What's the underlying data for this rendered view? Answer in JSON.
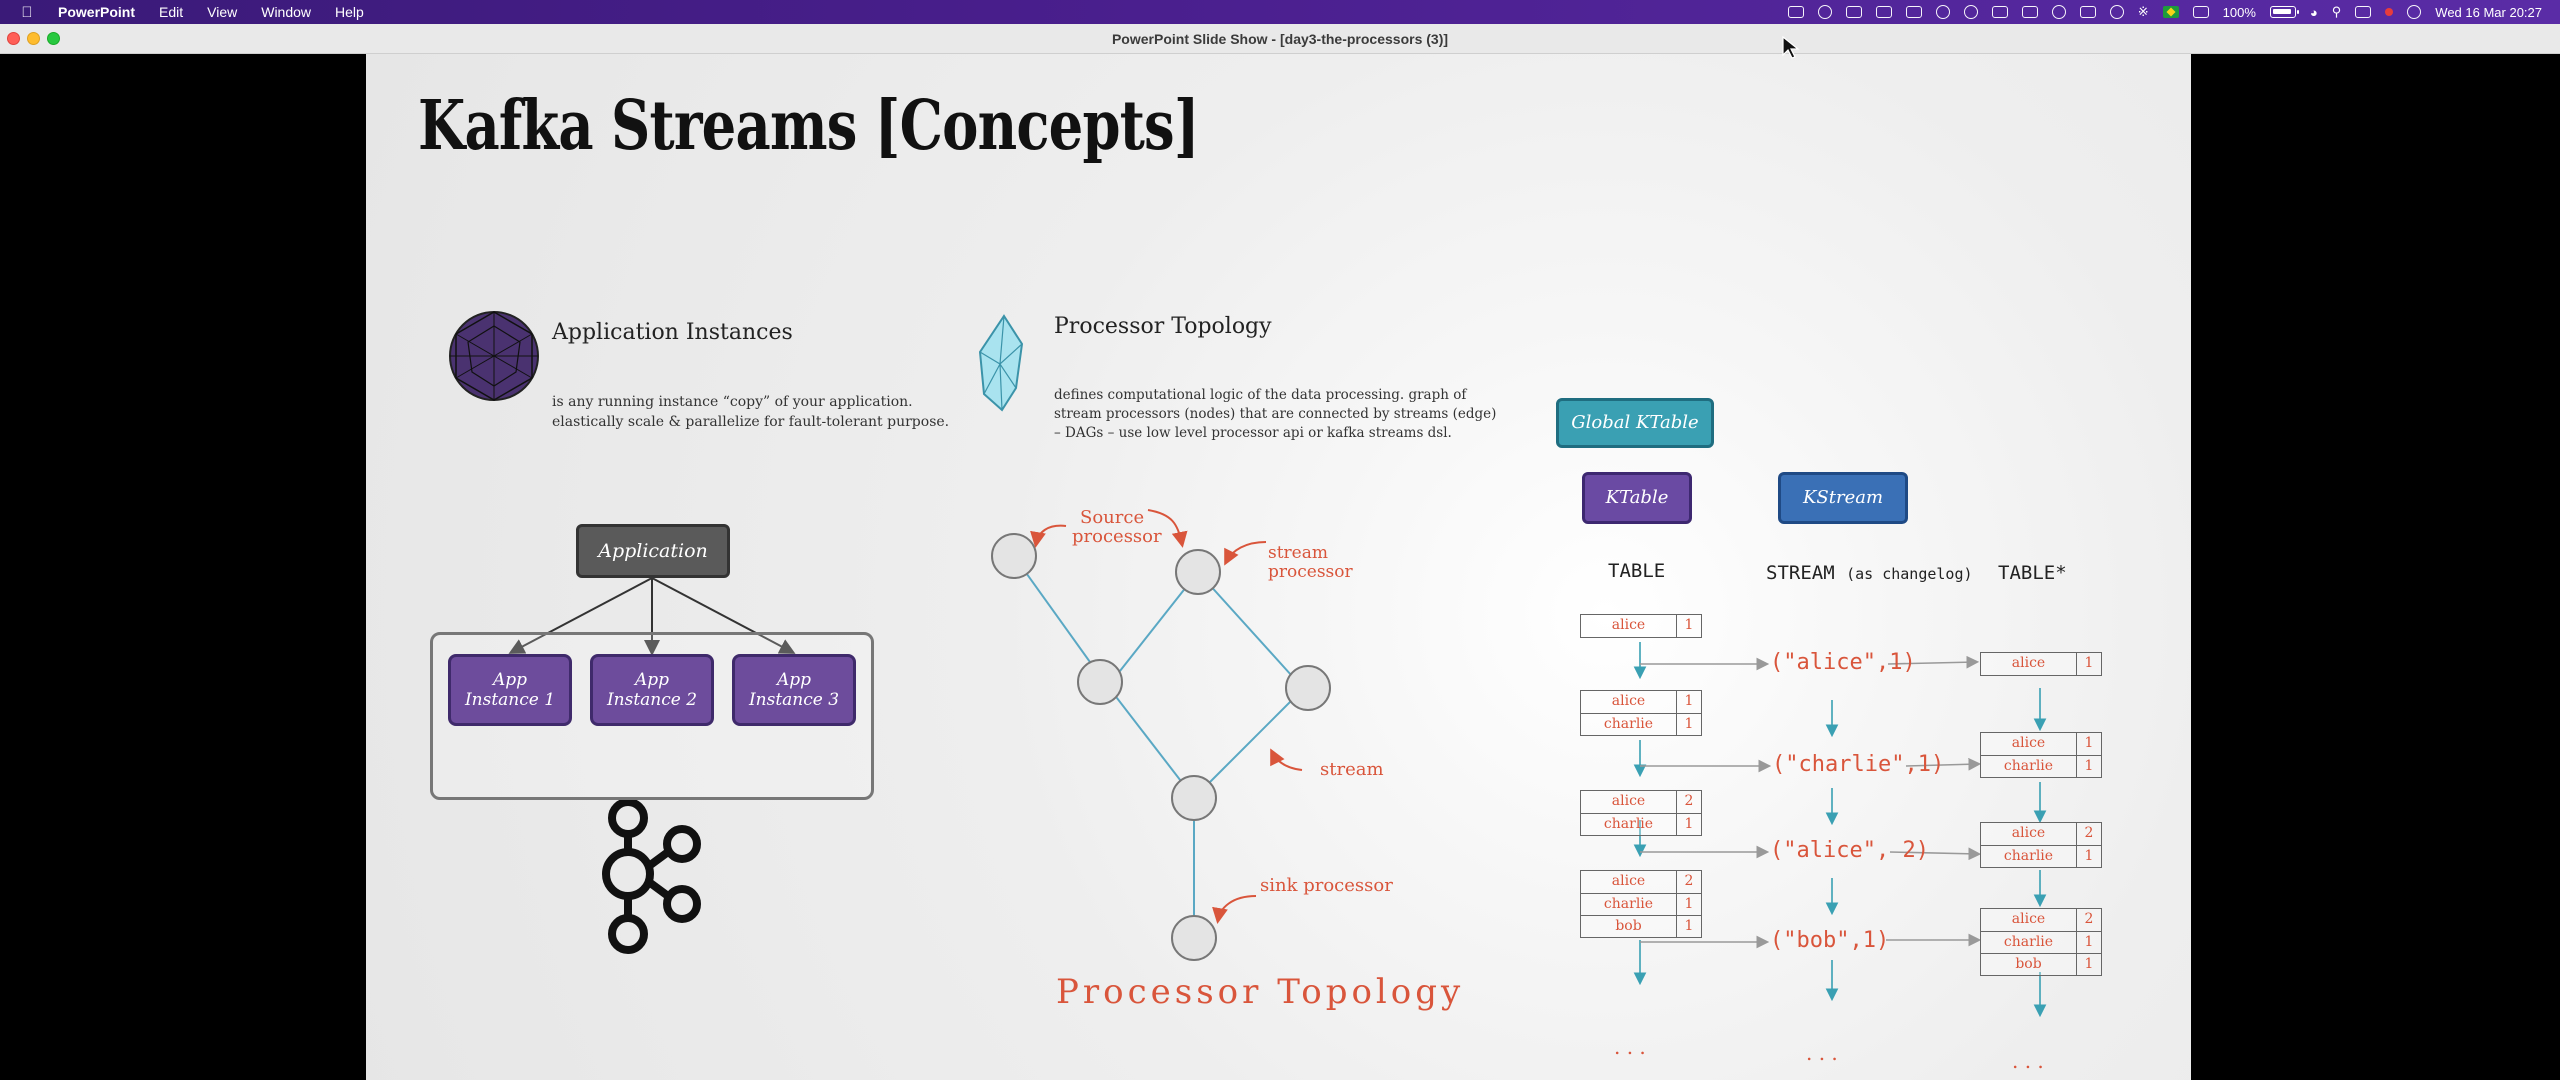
{
  "menubar": {
    "apple_icon": "apple-icon",
    "app_name": "PowerPoint",
    "menus": [
      "Edit",
      "View",
      "Window",
      "Help"
    ],
    "battery": "100%",
    "datetime": "Wed 16 Mar  20:27"
  },
  "window": {
    "title": "PowerPoint Slide Show - [day3-the-processors (3)]"
  },
  "slide": {
    "title": "Kafka Streams [Concepts]",
    "app_instances": {
      "heading": "Application Instances",
      "text_lines": [
        "is any running instance “copy” of your application.",
        "elastically scale & parallelize for fault-tolerant purpose."
      ],
      "application": "Application",
      "instances": [
        [
          "App",
          "Instance 1"
        ],
        [
          "App",
          "Instance 2"
        ],
        [
          "App",
          "Instance 3"
        ]
      ]
    },
    "processor_topology": {
      "heading": "Processor Topology",
      "text_lines": [
        "defines computational logic of the data processing. graph of",
        "stream processors (nodes) that are connected by streams (edge)",
        "– DAGs – use low level processor api or kafka streams dsl."
      ],
      "labels": {
        "source": [
          "Source",
          "processor"
        ],
        "stream_processor": [
          "stream",
          "processor"
        ],
        "stream": "stream",
        "sink": "sink processor"
      },
      "footer": "Processor Topology"
    },
    "duality": {
      "global_ktable": "Global KTable",
      "ktable": "KTable",
      "kstream": "KStream",
      "col_table": "TABLE",
      "col_stream": "STREAM",
      "col_stream_note": "(as changelog)",
      "col_table2": "TABLE*",
      "left_tables": [
        [
          [
            "alice",
            "1"
          ]
        ],
        [
          [
            "alice",
            "1"
          ],
          [
            "charlie",
            "1"
          ]
        ],
        [
          [
            "alice",
            "2"
          ],
          [
            "charlie",
            "1"
          ]
        ],
        [
          [
            "alice",
            "2"
          ],
          [
            "charlie",
            "1"
          ],
          [
            "bob",
            "1"
          ]
        ]
      ],
      "stream_events": [
        "(\"alice\",1)",
        "(\"charlie\",1)",
        "(\"alice\", 2)",
        "(\"bob\",1)"
      ],
      "right_tables": [
        [
          [
            "alice",
            "1"
          ]
        ],
        [
          [
            "alice",
            "1"
          ],
          [
            "charlie",
            "1"
          ]
        ],
        [
          [
            "alice",
            "2"
          ],
          [
            "charlie",
            "1"
          ]
        ],
        [
          [
            "alice",
            "2"
          ],
          [
            "charlie",
            "1"
          ],
          [
            "bob",
            "1"
          ]
        ]
      ],
      "ellipsis": ". . ."
    }
  }
}
